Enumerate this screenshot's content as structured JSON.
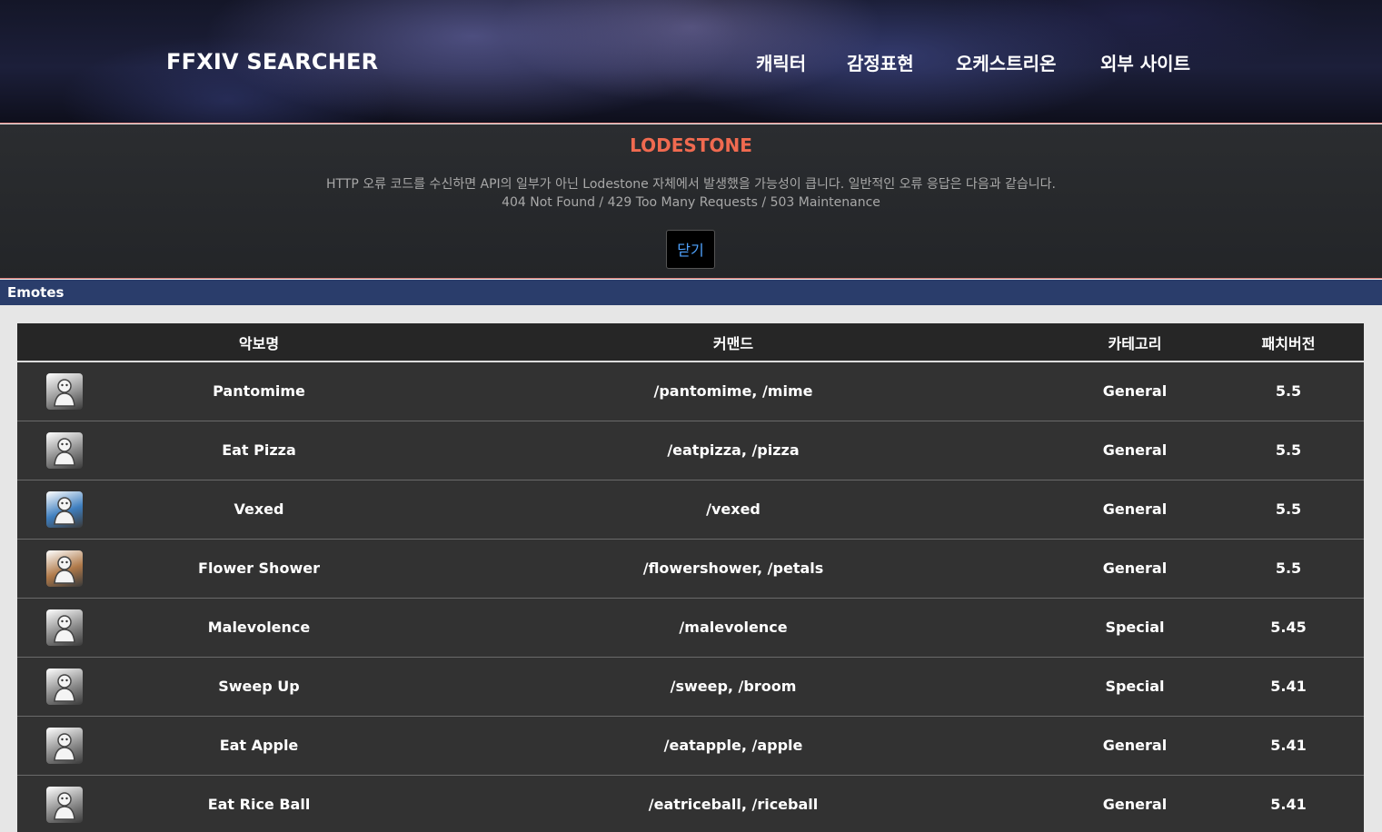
{
  "header": {
    "brand": "FFXIV SEARCHER",
    "nav": [
      {
        "label": "캐릭터"
      },
      {
        "label": "감정표현"
      },
      {
        "label": "오케스트리온"
      },
      {
        "label": "외부 사이트"
      }
    ]
  },
  "notice": {
    "title": "LODESTONE",
    "line1": "HTTP 오류 코드를 수신하면 API의 일부가 아닌 Lodestone 자체에서 발생했을 가능성이 큽니다. 일반적인 오류 응답은 다음과 같습니다.",
    "line2": "404 Not Found / 429 Too Many Requests / 503 Maintenance",
    "close_label": "닫기"
  },
  "section": {
    "title": "Emotes"
  },
  "table": {
    "headers": [
      "악보명",
      "커맨드",
      "카테고리",
      "패치버전"
    ],
    "rows": [
      {
        "icon": "pantomime-icon",
        "icon_color": "#9a9a9a",
        "name": "Pantomime",
        "command": "/pantomime, /mime",
        "category": "General",
        "patch": "5.5"
      },
      {
        "icon": "eat-pizza-icon",
        "icon_color": "#8e8e8e",
        "name": "Eat Pizza",
        "command": "/eatpizza, /pizza",
        "category": "General",
        "patch": "5.5"
      },
      {
        "icon": "vexed-icon",
        "icon_color": "#3f7fbf",
        "name": "Vexed",
        "command": "/vexed",
        "category": "General",
        "patch": "5.5"
      },
      {
        "icon": "flower-shower-icon",
        "icon_color": "#b07a4a",
        "name": "Flower Shower",
        "command": "/flowershower, /petals",
        "category": "General",
        "patch": "5.5"
      },
      {
        "icon": "malevolence-icon",
        "icon_color": "#8c8c8c",
        "name": "Malevolence",
        "command": "/malevolence",
        "category": "Special",
        "patch": "5.45"
      },
      {
        "icon": "sweep-up-icon",
        "icon_color": "#8c8c8c",
        "name": "Sweep Up",
        "command": "/sweep, /broom",
        "category": "Special",
        "patch": "5.41"
      },
      {
        "icon": "eat-apple-icon",
        "icon_color": "#8e8e8e",
        "name": "Eat Apple",
        "command": "/eatapple, /apple",
        "category": "General",
        "patch": "5.41"
      },
      {
        "icon": "eat-rice-ball-icon",
        "icon_color": "#8e8e8e",
        "name": "Eat Rice Ball",
        "command": "/eatriceball, /riceball",
        "category": "General",
        "patch": "5.41"
      }
    ]
  }
}
